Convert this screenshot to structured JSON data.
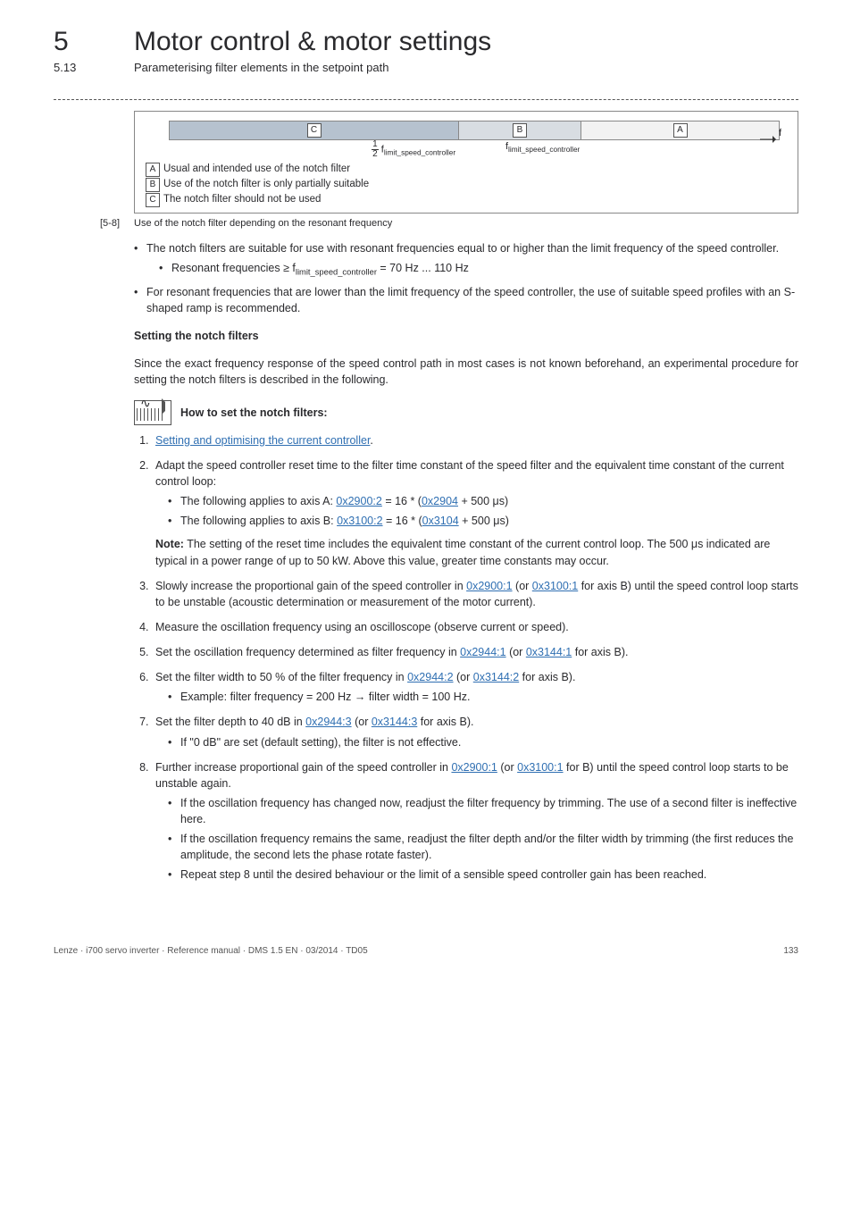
{
  "chapter_number": "5",
  "chapter_title": "Motor control & motor settings",
  "section_number": "5.13",
  "section_title": "Parameterising filter elements in the setpoint path",
  "figure": {
    "label_c": "C",
    "label_b": "B",
    "label_a": "A",
    "axis_end": "f",
    "tick1_prefix_num": "1",
    "tick1_prefix_den": "2",
    "tick1_label": "f",
    "tick1_sub": "limit_speed_controller",
    "tick2_label": "f",
    "tick2_sub": "limit_speed_controller",
    "legend_a": "Usual and intended use of the notch filter",
    "legend_b": "Use of the notch filter is only partially suitable",
    "legend_c": "The notch filter should not be used",
    "caption_ref": "[5-8]",
    "caption_text": "Use of the notch filter depending on the resonant frequency"
  },
  "bullet1": "The notch filters are suitable for use with resonant frequencies equal to or higher than the limit frequency of the speed controller.",
  "bullet1_sub": "Resonant frequencies ≥  f",
  "bullet1_sub_suffix": " = 70 Hz  ... 110 Hz",
  "bullet1_sub_sub": "limit_speed_controller",
  "bullet2": "For resonant frequencies that are lower than the limit frequency of the speed controller, the use of suitable speed profiles with an S-shaped ramp is recommended.",
  "h_setting": "Setting the notch filters",
  "p_intro": "Since the exact frequency response of the speed control path in most cases is not known beforehand, an experimental procedure for setting the notch filters is described in the following.",
  "howto_title": "How to set the notch filters:",
  "steps": {
    "s1_link": "Setting and optimising the current controller",
    "s1_suffix": ".",
    "s2_main": "Adapt the speed controller reset time to the filter time constant of the speed filter and the equivalent time constant of the current control loop:",
    "s2_a_pre": "The following applies to axis A: ",
    "s2_a_l1": "0x2900:2",
    "s2_a_mid": " = 16 * (",
    "s2_a_l2": "0x2904",
    "s2_a_post": " + 500 μs)",
    "s2_b_pre": "The following applies to axis B: ",
    "s2_b_l1": "0x3100:2",
    "s2_b_mid": " = 16 * (",
    "s2_b_l2": "0x3104",
    "s2_b_post": " + 500 μs)",
    "s2_note_label": "Note:",
    "s2_note": " The setting of the reset time includes the equivalent time constant of the current control loop. The 500 μs indicated are typical in a power range of up to 50 kW. Above this value, greater time constants may occur.",
    "s3_pre": "Slowly increase the proportional gain of the speed controller in ",
    "s3_l1": "0x2900:1",
    "s3_mid": " (or ",
    "s3_l2": "0x3100:1",
    "s3_post": " for axis B) until the speed control loop starts to be unstable (acoustic determination or measurement of the motor current).",
    "s4": "Measure the oscillation frequency using an oscilloscope (observe current or speed).",
    "s5_pre": "Set the oscillation frequency determined as filter frequency in ",
    "s5_l1": "0x2944:1",
    "s5_mid": " (or ",
    "s5_l2": "0x3144:1",
    "s5_post": " for axis B).",
    "s6_pre": "Set the filter width to 50 % of the filter frequency in ",
    "s6_l1": "0x2944:2",
    "s6_mid": " (or ",
    "s6_l2": "0x3144:2",
    "s6_post": " for axis B).",
    "s6_sub": "Example: filter frequency = 200 Hz → filter width = 100 Hz.",
    "s7_pre": "Set the filter depth to 40 dB in ",
    "s7_l1": "0x2944:3",
    "s7_mid": " (or ",
    "s7_l2": "0x3144:3",
    "s7_post": " for axis B).",
    "s7_sub": "If \"0 dB\" are set (default setting), the filter is not effective.",
    "s8_pre": "Further increase proportional gain of the speed controller in ",
    "s8_l1": "0x2900:1",
    "s8_mid": " (or ",
    "s8_l2": "0x3100:1",
    "s8_post": " for B) until the speed control loop starts to be unstable again.",
    "s8_b1": "If the oscillation frequency has changed now, readjust the filter frequency by trimming. The use of a second filter is ineffective here.",
    "s8_b2": "If the oscillation frequency remains the same, readjust the filter depth and/or the filter width by trimming (the first reduces the amplitude, the second lets the phase rotate faster).",
    "s8_b3": "Repeat step 8 until the desired behaviour or the limit of a sensible speed controller gain has been reached."
  },
  "footer_left": "Lenze · i700 servo inverter · Reference manual · DMS 1.5 EN · 03/2014 · TD05",
  "footer_right": "133"
}
